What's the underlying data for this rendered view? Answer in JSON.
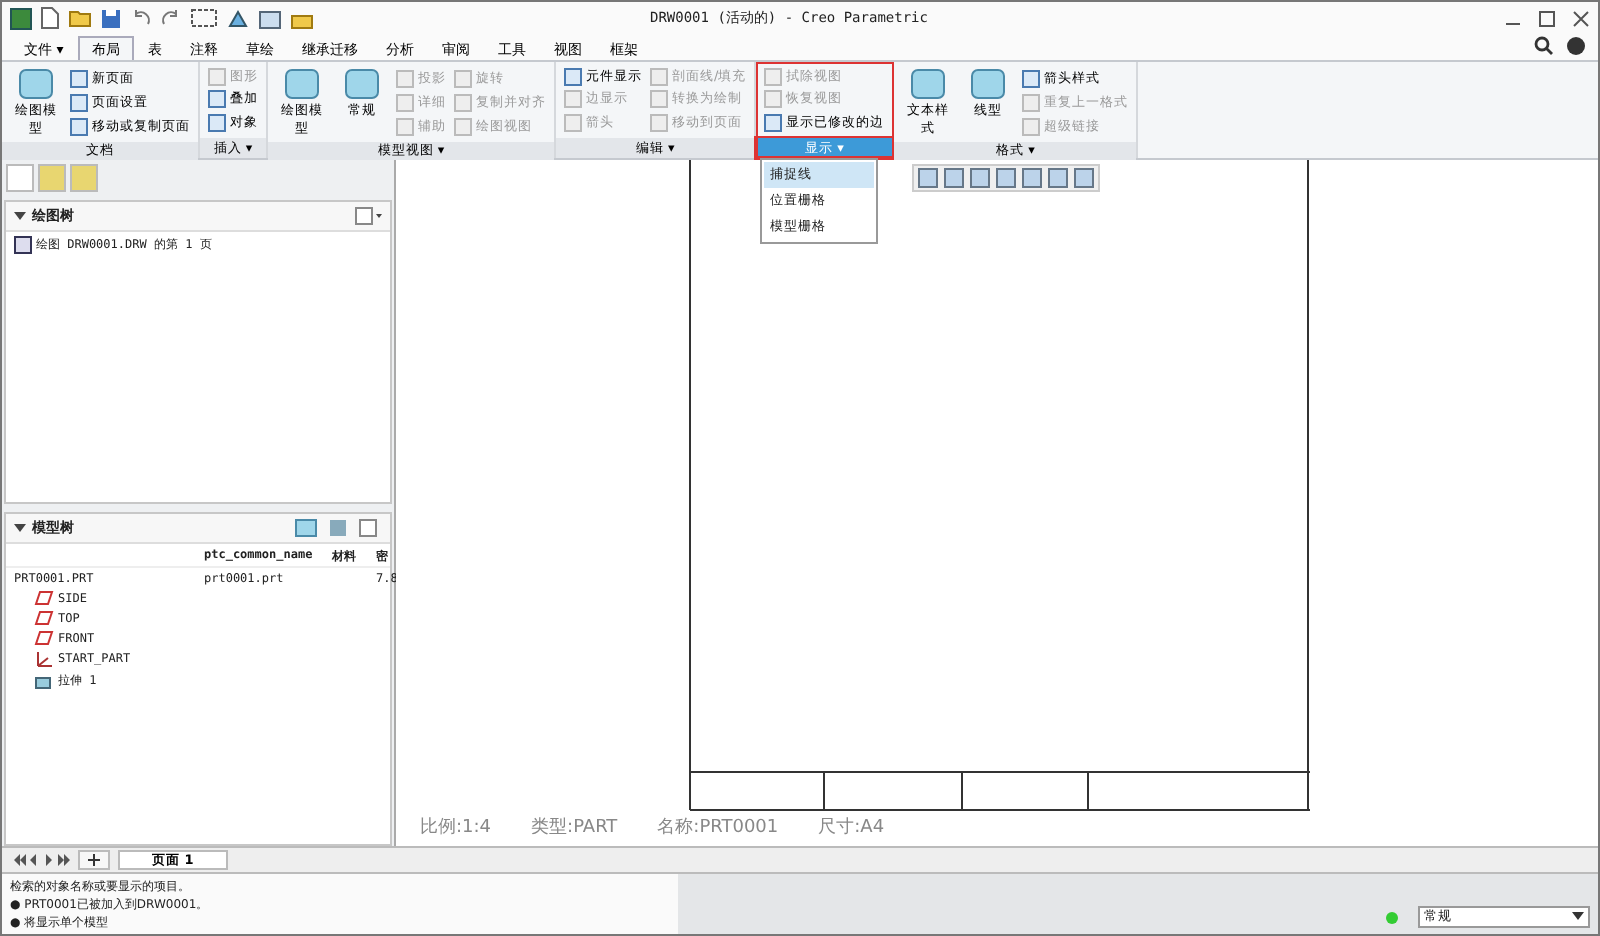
{
  "window": {
    "title": "DRW0001 (活动的) - Creo Parametric"
  },
  "ribbon_tabs": [
    {
      "label": "文件 ▾",
      "selected": false
    },
    {
      "label": "布局",
      "selected": true
    },
    {
      "label": "表",
      "selected": false
    },
    {
      "label": "注释",
      "selected": false
    },
    {
      "label": "草绘",
      "selected": false
    },
    {
      "label": "继承迁移",
      "selected": false
    },
    {
      "label": "分析",
      "selected": false
    },
    {
      "label": "审阅",
      "selected": false
    },
    {
      "label": "工具",
      "selected": false
    },
    {
      "label": "视图",
      "selected": false
    },
    {
      "label": "框架",
      "selected": false
    }
  ],
  "ribbon_groups": [
    {
      "label": "文档",
      "big": [
        {
          "label": "绘图模型"
        }
      ],
      "small": [
        {
          "label": "新页面",
          "disabled": false
        },
        {
          "label": "页面设置",
          "disabled": false
        },
        {
          "label": "移动或复制页面",
          "disabled": false
        }
      ]
    },
    {
      "label": "插入 ▾",
      "small": [
        {
          "label": "图形",
          "disabled": true
        },
        {
          "label": "叠加",
          "disabled": false
        },
        {
          "label": "对象",
          "disabled": false
        }
      ]
    },
    {
      "label": "模型视图 ▾",
      "big": [
        {
          "label": "绘图模型"
        },
        {
          "label": "常规"
        }
      ],
      "small": [
        {
          "label": "投影",
          "disabled": true
        },
        {
          "label": "详细",
          "disabled": true
        },
        {
          "label": "辅助",
          "disabled": true
        },
        {
          "label": "旋转",
          "disabled": true
        },
        {
          "label": "复制并对齐",
          "disabled": true
        },
        {
          "label": "绘图视图",
          "disabled": true
        }
      ]
    },
    {
      "label": "编辑 ▾",
      "small": [
        {
          "label": "元件显示",
          "disabled": false
        },
        {
          "label": "边显示",
          "disabled": true
        },
        {
          "label": "箭头",
          "disabled": true
        },
        {
          "label": "剖面线/填充",
          "disabled": true
        },
        {
          "label": "转换为绘制",
          "disabled": true
        },
        {
          "label": "移动到页面",
          "disabled": true
        }
      ]
    },
    {
      "label": "显示 ▾",
      "small": [
        {
          "label": "拭除视图",
          "disabled": true
        },
        {
          "label": "恢复视图",
          "disabled": true
        },
        {
          "label": "显示已修改的边",
          "disabled": false
        }
      ]
    },
    {
      "label": "格式 ▾",
      "big": [
        {
          "label": "文本样式"
        },
        {
          "label": "线型"
        }
      ],
      "small": [
        {
          "label": "箭头样式",
          "disabled": false
        },
        {
          "label": "重复上一格式",
          "disabled": true
        },
        {
          "label": "超级链接",
          "disabled": true
        }
      ]
    }
  ],
  "display_menu": {
    "items": [
      {
        "label": "捕捉线",
        "selected": true
      },
      {
        "label": "位置栅格",
        "selected": false
      },
      {
        "label": "模型栅格",
        "selected": false
      }
    ]
  },
  "drawing_tree": {
    "title": "绘图树",
    "expanded": true,
    "items": [
      "绘图 DRW0001.DRW 的第 1 页"
    ]
  },
  "model_tree": {
    "title": "模型树",
    "expanded": true,
    "columns": [
      "ptc_common_name",
      "材料",
      "密"
    ],
    "root": {
      "label": "PRT0001.PRT",
      "cells": [
        "prt0001.prt",
        "",
        "7.8"
      ],
      "children": [
        {
          "label": "SIDE",
          "kind": "plane"
        },
        {
          "label": "TOP",
          "kind": "plane"
        },
        {
          "label": "FRONT",
          "kind": "plane"
        },
        {
          "label": "START_PART",
          "kind": "csys"
        },
        {
          "label": "拉伸 1",
          "kind": "feature"
        }
      ]
    }
  },
  "sheet_info": [
    "比例:1:4",
    "类型:PART",
    "名称:PRT0001",
    "尺寸:A4"
  ],
  "page_tabs": [
    {
      "label": "页面 1",
      "selected": true
    }
  ],
  "messages": [
    "检索的对象名称或要显示的项目。",
    "● PRT0001已被加入到DRW0001。",
    "● 将显示单个模型"
  ],
  "filter": {
    "value": "常规"
  }
}
